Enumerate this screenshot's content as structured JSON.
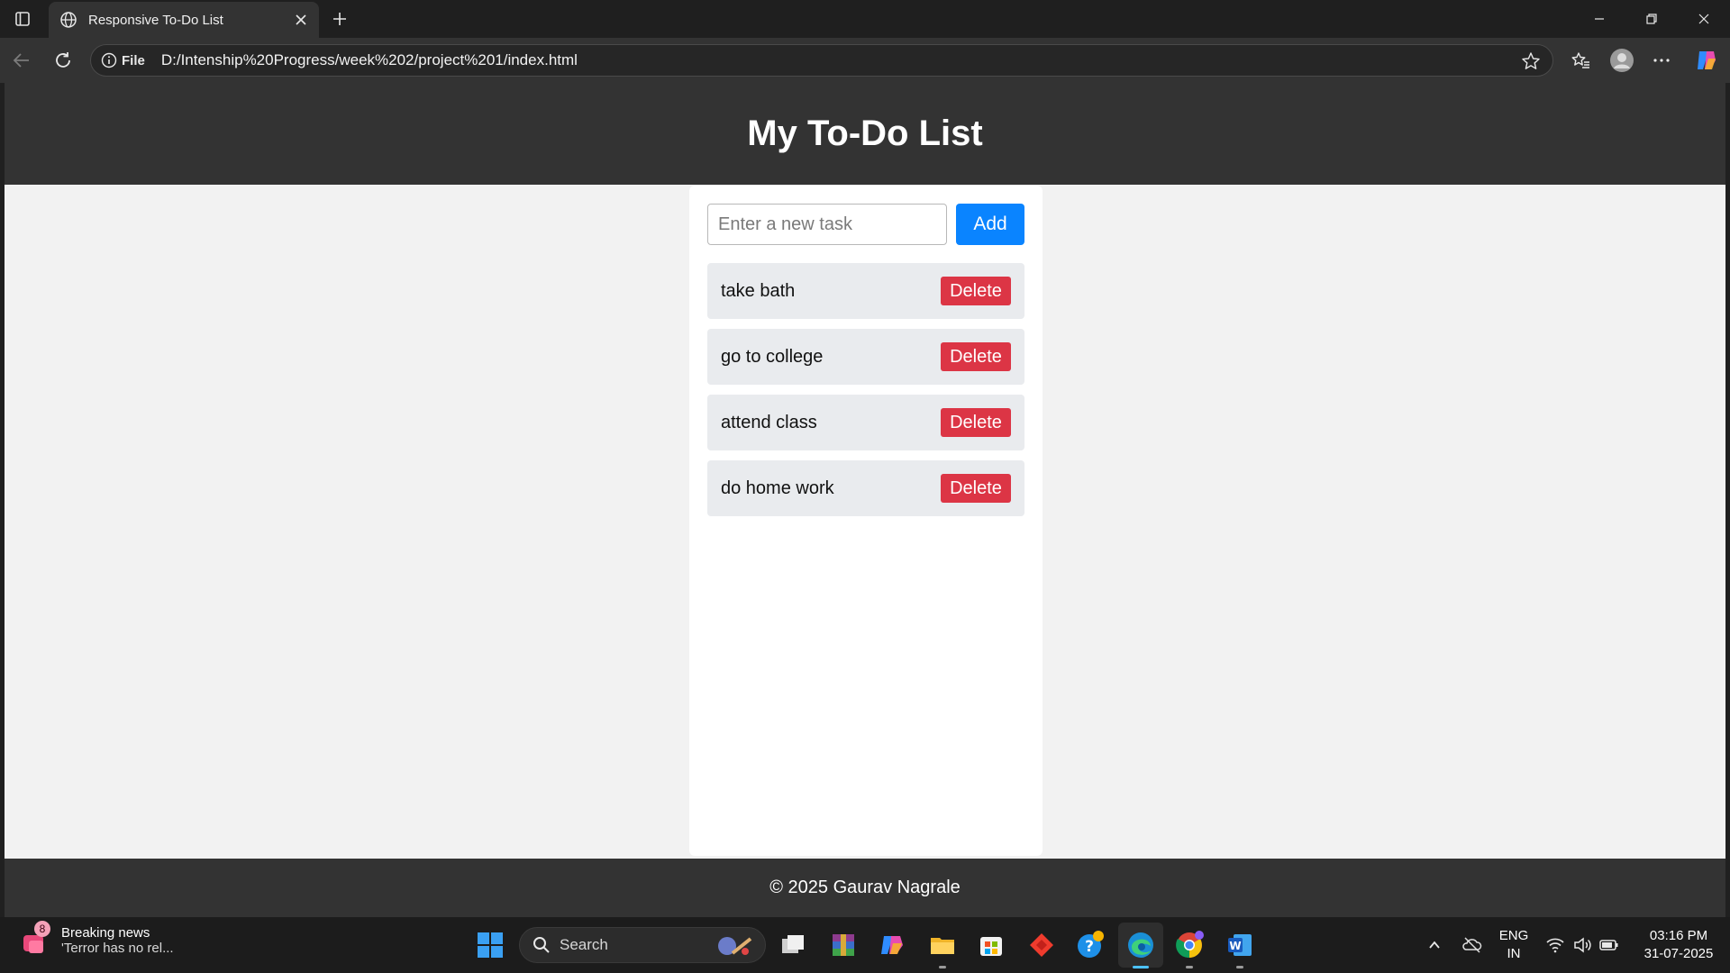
{
  "browser": {
    "tab_title": "Responsive To-Do List",
    "address_scheme": "File",
    "address_url": "D:/Intenship%20Progress/week%202/project%201/index.html"
  },
  "page": {
    "header_title": "My To-Do List",
    "input_placeholder": "Enter a new task",
    "input_value": "",
    "add_label": "Add",
    "tasks": [
      {
        "text": "take bath",
        "delete_label": "Delete"
      },
      {
        "text": "go to college",
        "delete_label": "Delete"
      },
      {
        "text": "attend class",
        "delete_label": "Delete"
      },
      {
        "text": "do home work",
        "delete_label": "Delete"
      }
    ],
    "footer_text": "© 2025 Gaurav Nagrale"
  },
  "taskbar": {
    "news_badge": "8",
    "news_title": "Breaking news",
    "news_subtitle": "'Terror has no rel...",
    "search_label": "Search",
    "language_line1": "ENG",
    "language_line2": "IN",
    "time": "03:16 PM",
    "date": "31-07-2025"
  },
  "colors": {
    "header_bg": "#333333",
    "page_bg": "#f2f2f2",
    "add_button": "#0a84ff",
    "delete_button": "#dc3545",
    "task_bg": "#e9ebee"
  },
  "icons": [
    "tab-actions-icon",
    "globe-icon",
    "close-icon",
    "plus-icon",
    "minimize-icon",
    "restore-icon",
    "back-icon",
    "refresh-icon",
    "info-icon",
    "star-icon",
    "favorites-icon",
    "profile-icon",
    "more-icon",
    "copilot-icon",
    "windows-start-icon",
    "search-icon"
  ]
}
